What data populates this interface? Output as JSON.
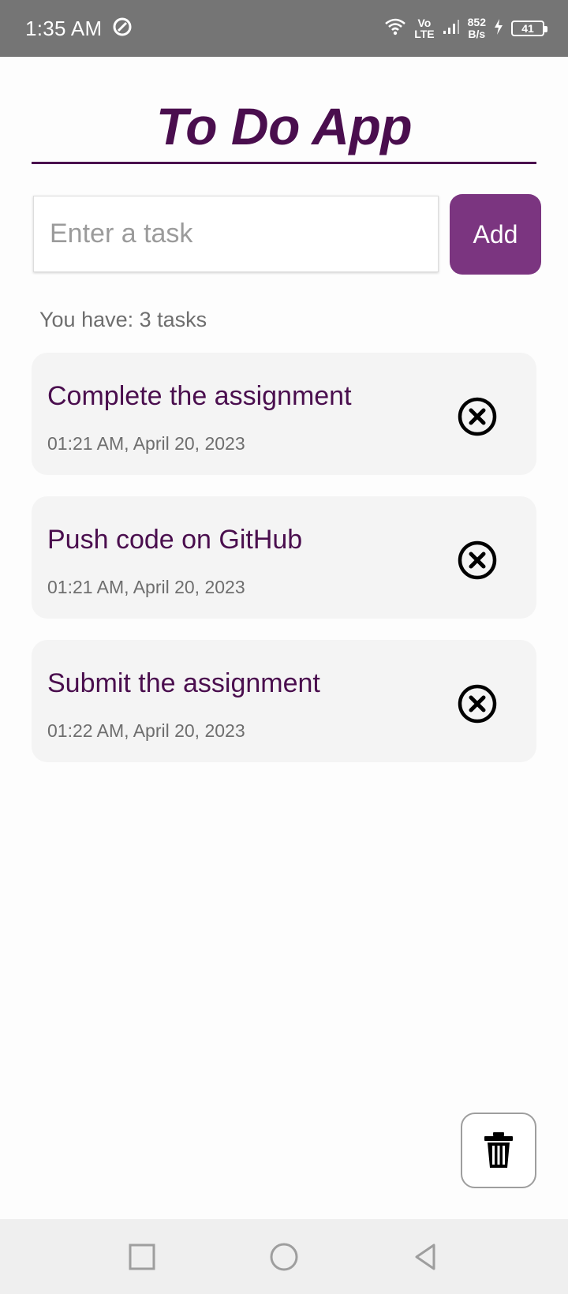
{
  "status_bar": {
    "time": "1:35 AM",
    "network_top": "Vo",
    "network_bottom": "LTE",
    "speed_value": "852",
    "speed_unit": "B/s",
    "battery": "41"
  },
  "app": {
    "title": "To Do App",
    "input_placeholder": "Enter a task",
    "input_value": "",
    "add_label": "Add",
    "task_count_text": "You have: 3 tasks"
  },
  "tasks": [
    {
      "title": "Complete the assignment",
      "time": "01:21 AM, April 20, 2023"
    },
    {
      "title": "Push code on GitHub",
      "time": "01:21 AM, April 20, 2023"
    },
    {
      "title": "Submit the assignment",
      "time": "01:22 AM, April 20, 2023"
    }
  ],
  "icons": {
    "delete_task": "close-circle-icon",
    "clear_all": "trash-icon",
    "nav": [
      "square-icon",
      "circle-icon",
      "triangle-back-icon"
    ]
  },
  "colors": {
    "accent": "#4a0e4e",
    "button": "#7b3580",
    "status_bar": "#757575",
    "card": "#f4f4f4"
  }
}
